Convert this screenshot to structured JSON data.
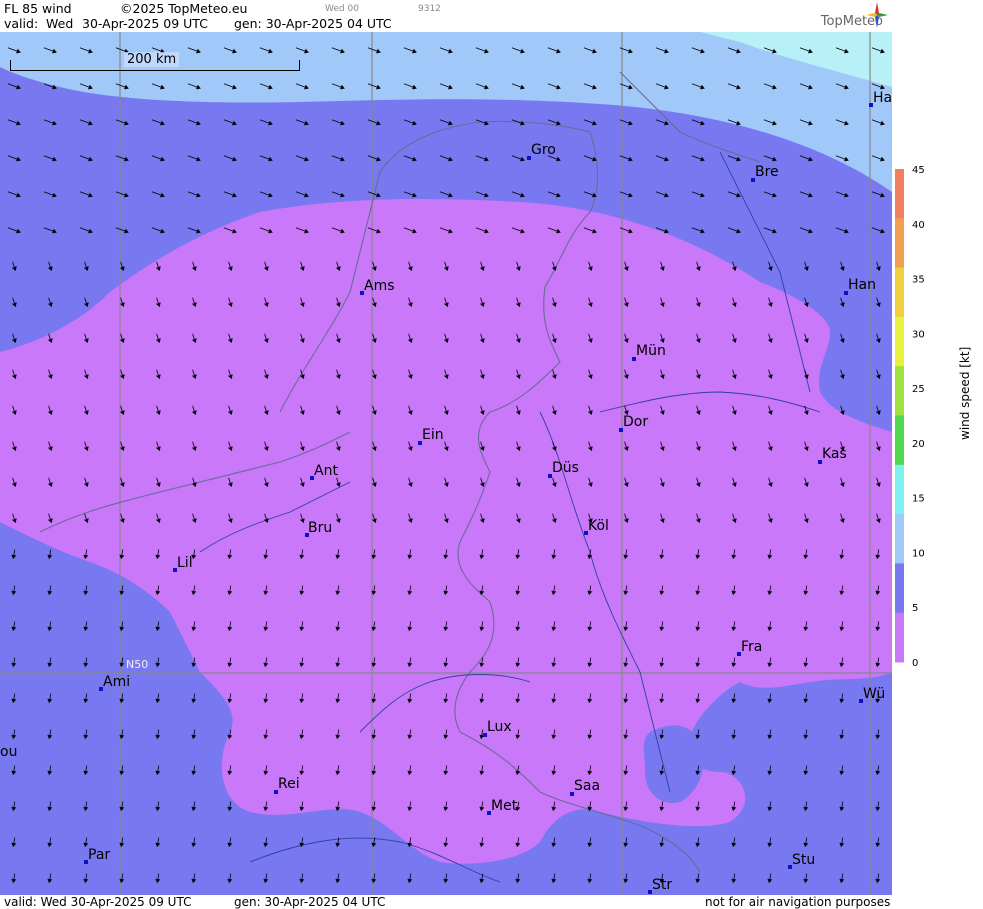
{
  "header": {
    "product": "FL 85 wind",
    "copyright": "©2025 TopMeteo.eu",
    "valid_label": "valid:",
    "valid_day": "Wed",
    "valid_time": "30-Apr-2025  09 UTC",
    "gen": "gen: 30-Apr-2025 04 UTC",
    "small_run": "Wed 00",
    "small_id": "9312",
    "logo_text": "TopMeteo"
  },
  "footer": {
    "valid": "valid:  Wed  30-Apr-2025  09 UTC",
    "gen": "gen: 30-Apr-2025 04 UTC",
    "disclaimer": "not for air navigation purposes"
  },
  "scale_bar": {
    "label": "200 km"
  },
  "grid_label": "N50",
  "legend": {
    "title": "wind  speed  [kt]",
    "ticks": [
      "45",
      "40",
      "35",
      "30",
      "25",
      "20",
      "15",
      "10",
      "5",
      "0"
    ],
    "colors": [
      "#f08060",
      "#f0a050",
      "#f0d040",
      "#e8f040",
      "#a0e040",
      "#50d850",
      "#80f0f0",
      "#a0c8f8",
      "#7878f0",
      "#c878f8"
    ]
  },
  "cities": [
    {
      "name": "Gro"
    },
    {
      "name": "Bre"
    },
    {
      "name": "Ha"
    },
    {
      "name": "Ams"
    },
    {
      "name": "Han"
    },
    {
      "name": "Mün"
    },
    {
      "name": "Dor"
    },
    {
      "name": "Ein"
    },
    {
      "name": "Ant"
    },
    {
      "name": "Düs"
    },
    {
      "name": "Kas"
    },
    {
      "name": "Bru"
    },
    {
      "name": "Köl"
    },
    {
      "name": "Lil"
    },
    {
      "name": "Fra"
    },
    {
      "name": "Ami"
    },
    {
      "name": "Wü"
    },
    {
      "name": "ou"
    },
    {
      "name": "Lux"
    },
    {
      "name": "Rei"
    },
    {
      "name": "Saa"
    },
    {
      "name": "Met"
    },
    {
      "name": "Par"
    },
    {
      "name": "Stu"
    },
    {
      "name": "Str"
    }
  ],
  "colors": {
    "weak": "#c878f8",
    "mid": "#7878f0",
    "strong": "#a0c8f8",
    "top": "#b8f0f8",
    "marker": "#1010c8"
  }
}
